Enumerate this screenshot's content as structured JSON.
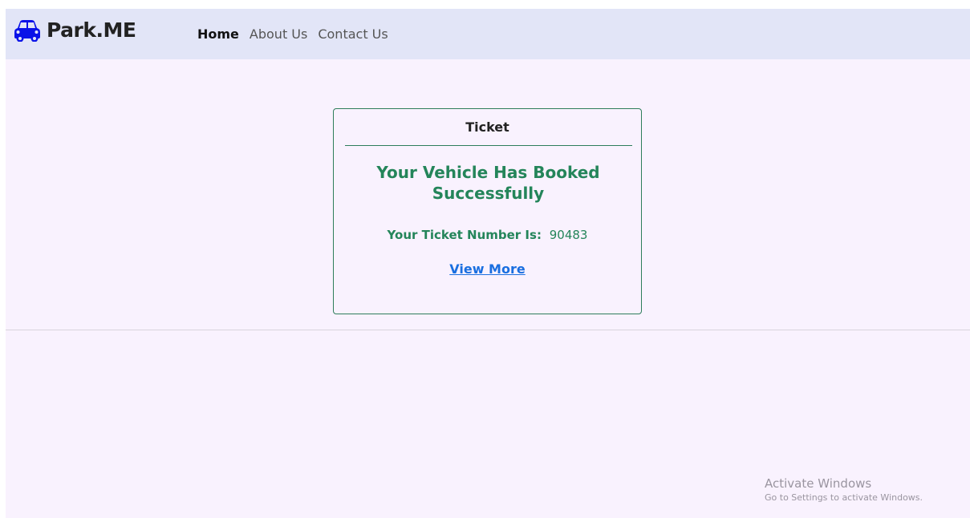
{
  "navbar": {
    "brand": {
      "icon": "car-icon",
      "label": "Park.ME",
      "color": "#0a12e8"
    },
    "links": [
      {
        "label": "Home",
        "active": true
      },
      {
        "label": "About Us",
        "active": false
      },
      {
        "label": "Contact Us",
        "active": false
      }
    ]
  },
  "ticket": {
    "title": "Ticket",
    "heading": "Your Vehicle Has Booked Successfully",
    "number_label": "Your Ticket Number Is:",
    "number_value": "90483",
    "view_more_label": "View More",
    "accent_color": "#24855a",
    "link_color": "#1a6fe0"
  },
  "watermark": {
    "title": "Activate Windows",
    "subtitle": "Go to Settings to activate Windows."
  }
}
